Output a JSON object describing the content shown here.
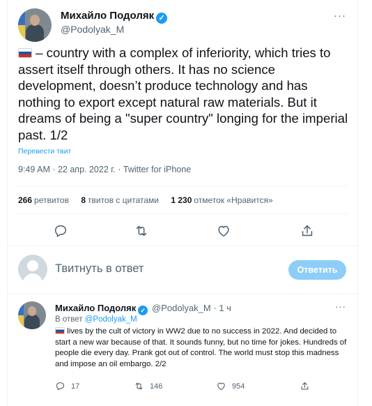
{
  "author": {
    "name": "Михайло Подоляк",
    "handle": "@Podolyak_M"
  },
  "tweet": {
    "text": "– country with a complex of inferiority, which tries to assert itself through others. It has no science development, doesn’t produce technology and has nothing to export except natural raw materials. But it dreams of being a \"super country\" longing for the imperial past. 1/2",
    "translate_link": "Перевести твит",
    "timestamp": "9:49 AM · 22 апр. 2022 г.",
    "source": "Twitter for iPhone"
  },
  "stats": {
    "retweets_count": "266",
    "retweets_label": "ретвитов",
    "quotes_count": "8",
    "quotes_label": "твитов с цитатами",
    "likes_count": "1 230",
    "likes_label": "отметок «Нравится»"
  },
  "reply_box": {
    "placeholder": "Твитнуть в ответ",
    "button_label": "Ответить"
  },
  "reply_tweet": {
    "name": "Михайло Подоляк",
    "handle": "@Podolyak_M",
    "time": "· 1 ч",
    "reply_to_prefix": "В ответ",
    "reply_to_handle": "@Podolyak_M",
    "text": "lives by the cult of victory in WW2 due to no success in 2022. And decided to start a new war because of that. It sounds funny, but no time for jokes. Hundreds of people die every day.  Prank got out of control. The world must stop this madness and impose an oil embargo. 2/2",
    "replies": "17",
    "retweets": "146",
    "likes": "954"
  },
  "colors": {
    "accent": "#1d9bf0",
    "text_primary": "#0f1419",
    "text_secondary": "#536471",
    "reply_button_disabled": "#8ecdf7"
  },
  "icons": [
    "verified-badge-icon",
    "more-icon",
    "reply-icon",
    "retweet-icon",
    "like-icon",
    "share-icon",
    "russia-flag-icon"
  ]
}
